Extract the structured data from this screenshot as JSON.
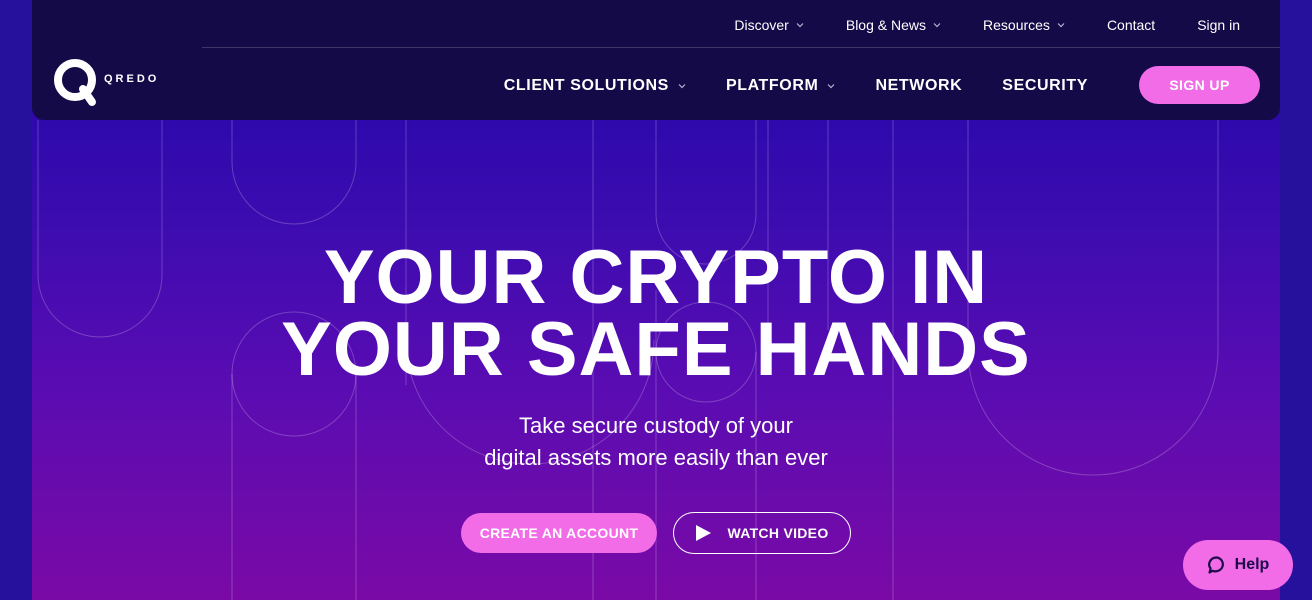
{
  "brand": {
    "wordmark": "QREDO",
    "logo_icon": "qredo-q-logo"
  },
  "util_nav": {
    "items": [
      {
        "label": "Discover",
        "has_dropdown": true
      },
      {
        "label": "Blog & News",
        "has_dropdown": true
      },
      {
        "label": "Resources",
        "has_dropdown": true
      },
      {
        "label": "Contact",
        "has_dropdown": false
      },
      {
        "label": "Sign in",
        "has_dropdown": false
      }
    ]
  },
  "main_nav": {
    "items": [
      {
        "label": "CLIENT SOLUTIONS",
        "has_dropdown": true
      },
      {
        "label": "PLATFORM",
        "has_dropdown": true
      },
      {
        "label": "NETWORK",
        "has_dropdown": false
      },
      {
        "label": "SECURITY",
        "has_dropdown": false
      }
    ],
    "signup_label": "SIGN UP"
  },
  "hero": {
    "headline_line1": "YOUR CRYPTO IN",
    "headline_line2": "YOUR SAFE HANDS",
    "subtext_line1": "Take secure custody of your",
    "subtext_line2": "digital assets more easily than ever",
    "cta_primary": "CREATE AN ACCOUNT",
    "cta_video": "WATCH VIDEO",
    "cta_video_icon": "play-icon"
  },
  "help_widget": {
    "label": "Help",
    "icon": "chat-bubble-icon"
  },
  "colors": {
    "accent_pink": "#f26ce8",
    "header_navy": "#130a47",
    "hero_top": "#2005a8",
    "hero_bottom": "#7a0aa6"
  }
}
